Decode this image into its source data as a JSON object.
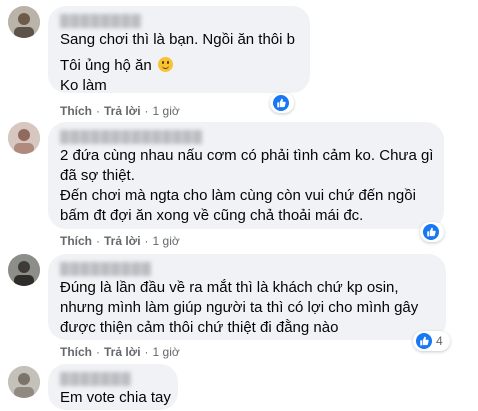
{
  "colors": {
    "bubble": "#f0f2f5",
    "like_blue": "#1877f2",
    "meta_text": "#65676b"
  },
  "actions": {
    "like": "Thích",
    "reply": "Trả lời",
    "separator": "·"
  },
  "comments": [
    {
      "lines": [
        "Sang chơi thì là bạn. Ngồi ăn thôi b",
        "Tôi ủng hộ ăn",
        "Ko làm"
      ],
      "emoji": "slightly-smiling-face",
      "time": "1 giờ",
      "reaction": {
        "icon": "like-icon",
        "count": ""
      }
    },
    {
      "lines": [
        "2 đứa cùng nhau nấu cơm có phải tình cảm ko. Chưa gì",
        "đã sợ thiệt.",
        "Đến chơi mà ngta cho làm cùng còn vui chứ đến ngồi",
        "bấm đt đợi ăn xong về cũng chả thoải mái đc."
      ],
      "time": "1 giờ",
      "reaction": {
        "icon": "like-icon",
        "count": ""
      }
    },
    {
      "lines": [
        "Đúng là lần đầu về ra mắt thì là khách chứ kp osin,",
        "nhưng mình làm giúp người ta thì có lợi cho mình gây",
        "được thiện cảm thôi chứ thiệt đi đằng nào"
      ],
      "time": "1 giờ",
      "reaction": {
        "icon": "like-icon",
        "count": "4"
      }
    },
    {
      "lines": [
        "Em vote chia tay"
      ]
    }
  ]
}
